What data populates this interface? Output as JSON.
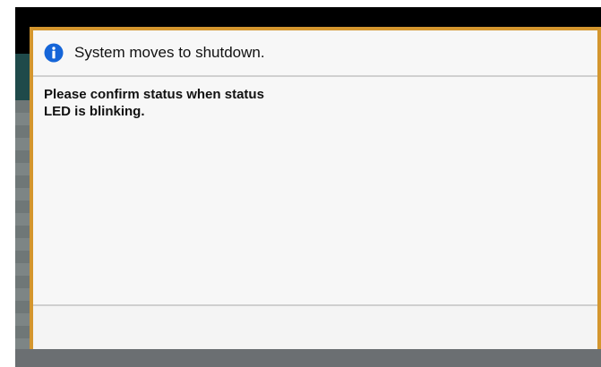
{
  "dialog": {
    "icon": "info-icon",
    "title": "System moves to shutdown.",
    "message_lines": [
      "Please confirm status when status",
      "LED is blinking."
    ],
    "colors": {
      "border": "#d4962e",
      "icon": "#1565d8",
      "background": "#f7f7f7"
    }
  }
}
